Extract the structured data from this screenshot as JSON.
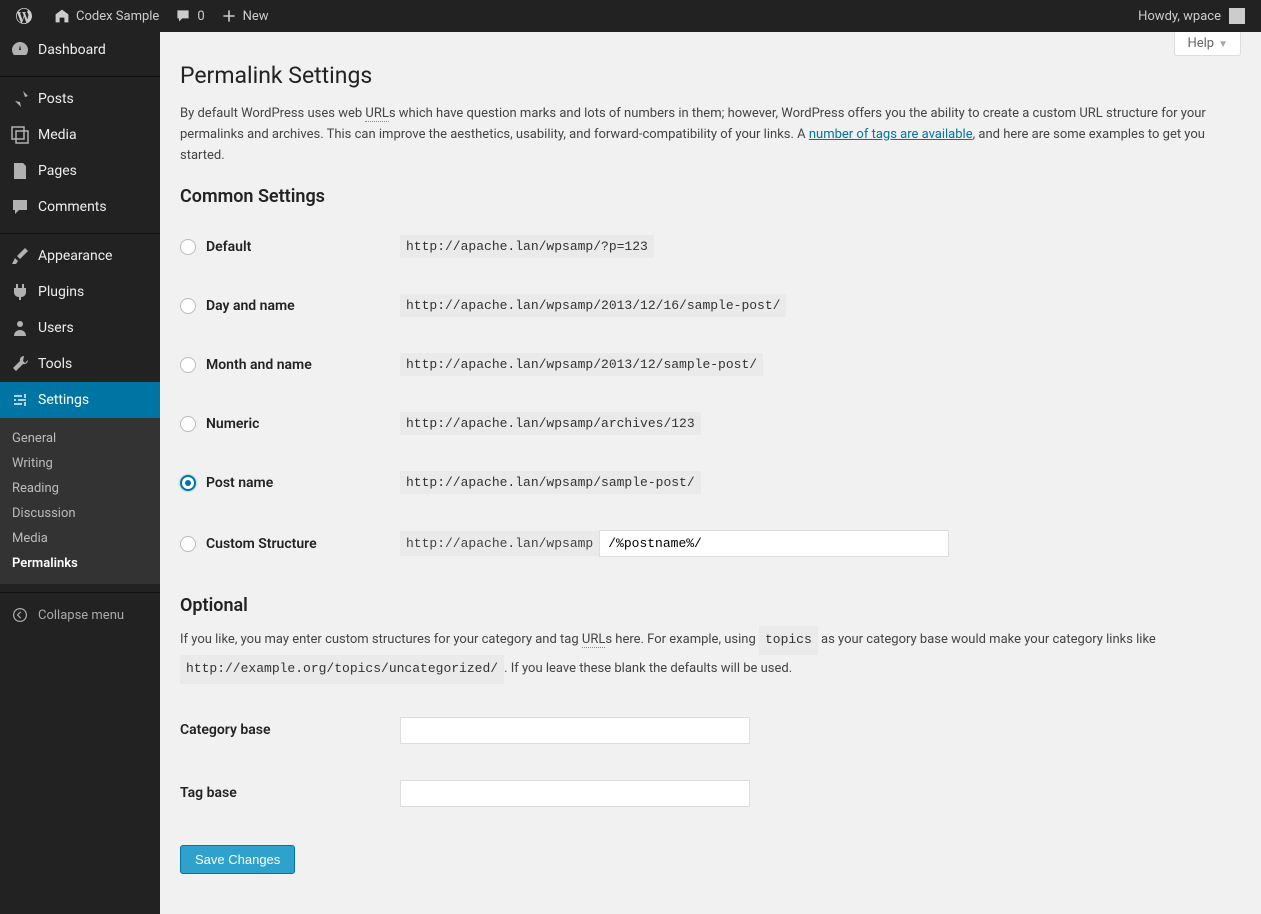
{
  "adminbar": {
    "site_name": "Codex Sample",
    "comments": "0",
    "new": "New",
    "howdy": "Howdy, wpace"
  },
  "sidebar": {
    "dashboard": "Dashboard",
    "posts": "Posts",
    "media": "Media",
    "pages": "Pages",
    "comments": "Comments",
    "appearance": "Appearance",
    "plugins": "Plugins",
    "users": "Users",
    "tools": "Tools",
    "settings": "Settings",
    "collapse": "Collapse menu",
    "submenu": {
      "general": "General",
      "writing": "Writing",
      "reading": "Reading",
      "discussion": "Discussion",
      "media": "Media",
      "permalinks": "Permalinks"
    }
  },
  "page": {
    "help": "Help",
    "title": "Permalink Settings",
    "intro_1": "By default WordPress uses web ",
    "intro_url": "URL",
    "intro_2": "s which have question marks and lots of numbers in them; however, WordPress offers you the ability to create a custom URL structure for your permalinks and archives. This can improve the aesthetics, usability, and forward-compatibility of your links. A ",
    "intro_link": "number of tags are available",
    "intro_3": ", and here are some examples to get you started."
  },
  "common": {
    "heading": "Common Settings",
    "options": {
      "default": {
        "label": "Default",
        "example": "http://apache.lan/wpsamp/?p=123"
      },
      "day_name": {
        "label": "Day and name",
        "example": "http://apache.lan/wpsamp/2013/12/16/sample-post/"
      },
      "month_name": {
        "label": "Month and name",
        "example": "http://apache.lan/wpsamp/2013/12/sample-post/"
      },
      "numeric": {
        "label": "Numeric",
        "example": "http://apache.lan/wpsamp/archives/123"
      },
      "post_name": {
        "label": "Post name",
        "example": "http://apache.lan/wpsamp/sample-post/"
      },
      "custom": {
        "label": "Custom Structure",
        "prefix": "http://apache.lan/wpsamp",
        "value": "/%postname%/"
      }
    }
  },
  "optional": {
    "heading": "Optional",
    "intro_1": "If you like, you may enter custom structures for your category and tag ",
    "intro_url": "URL",
    "intro_2": "s here. For example, using ",
    "intro_code1": "topics",
    "intro_3": " as your category base would make your category links like ",
    "intro_code2": "http://example.org/topics/uncategorized/",
    "intro_4": ". If you leave these blank the defaults will be used.",
    "category": "Category base",
    "tag": "Tag base"
  },
  "save": "Save Changes"
}
